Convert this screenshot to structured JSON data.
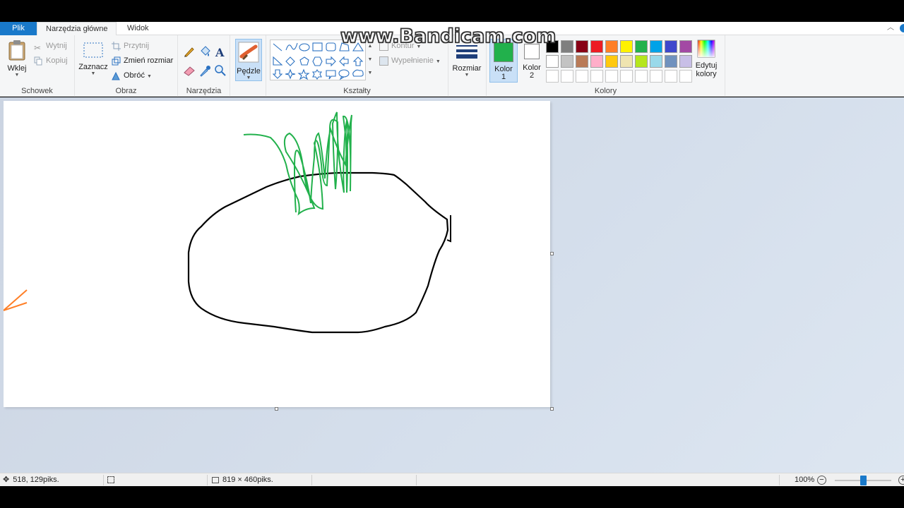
{
  "tabs": {
    "file": "Plik",
    "home": "Narzędzia główne",
    "view": "Widok"
  },
  "watermark": "www.Bandicam.com",
  "clipboard": {
    "group": "Schowek",
    "paste": "Wklej",
    "cut": "Wytnij",
    "copy": "Kopiuj"
  },
  "image": {
    "group": "Obraz",
    "select": "Zaznacz",
    "crop": "Przytnij",
    "resize": "Zmień rozmiar",
    "rotate": "Obróć"
  },
  "tools": {
    "group": "Narzędzia",
    "icons": [
      "pencil-icon",
      "fill-icon",
      "text-icon",
      "eraser-icon",
      "color-picker-icon",
      "magnifier-icon"
    ]
  },
  "brushes": {
    "label": "Pędzle"
  },
  "shapes": {
    "group": "Kształty",
    "outline": "Kontur",
    "fill": "Wypełnienie"
  },
  "size": {
    "label": "Rozmiar"
  },
  "colors": {
    "group": "Kolory",
    "color1_label": "Kolor",
    "color1_num": "1",
    "color2_label": "Kolor",
    "color2_num": "2",
    "edit_label1": "Edytuj",
    "edit_label2": "kolory",
    "color1_value": "#22b14c",
    "color2_value": "#ffffff",
    "palette_row1": [
      "#000000",
      "#7f7f7f",
      "#880015",
      "#ed1c24",
      "#ff7f27",
      "#fff200",
      "#22b14c",
      "#00a2e8",
      "#3f48cc",
      "#a349a4"
    ],
    "palette_row2": [
      "#ffffff",
      "#c3c3c3",
      "#b97a57",
      "#ffaec9",
      "#ffc90e",
      "#efe4b0",
      "#b5e61d",
      "#99d9ea",
      "#7092be",
      "#c8bfe7"
    ]
  },
  "status": {
    "cursor_pos": "518, 129piks.",
    "selection_size": "",
    "image_size": "819 × 460piks.",
    "zoom": "100%"
  }
}
